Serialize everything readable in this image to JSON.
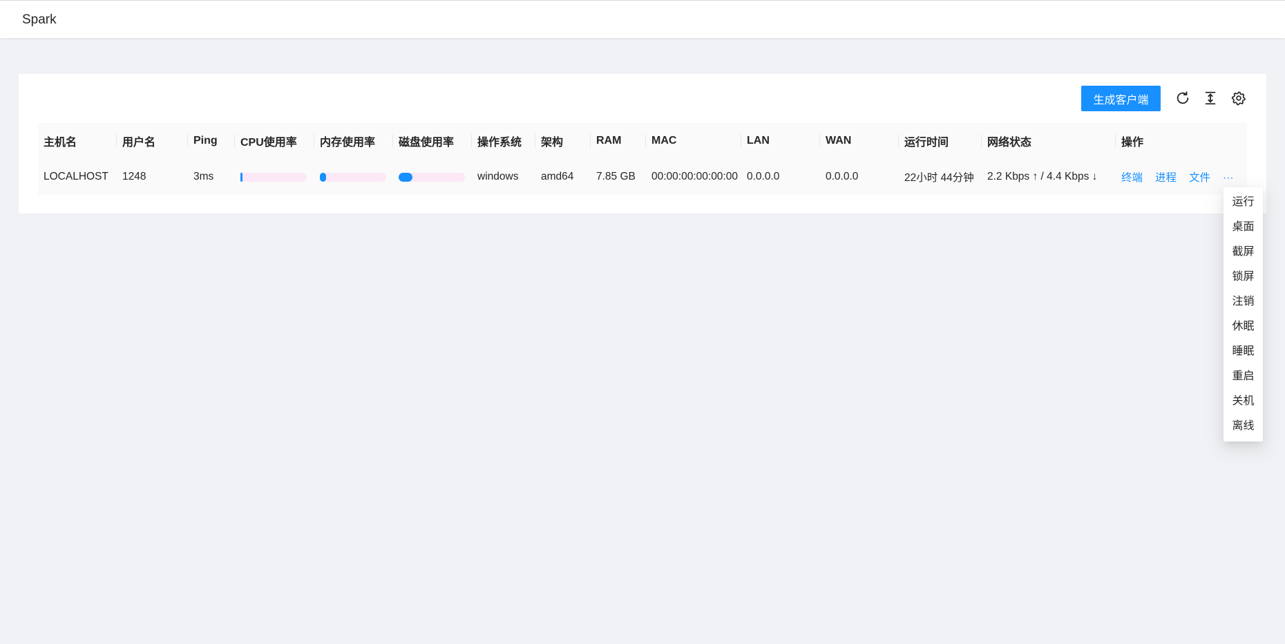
{
  "app": {
    "title": "Spark"
  },
  "toolbar": {
    "generate_client_label": "生成客户端",
    "icons": [
      "refresh-icon",
      "column-height-icon",
      "setting-icon"
    ]
  },
  "table": {
    "columns": [
      "主机名",
      "用户名",
      "Ping",
      "CPU使用率",
      "内存使用率",
      "磁盘使用率",
      "操作系统",
      "架构",
      "RAM",
      "MAC",
      "LAN",
      "WAN",
      "运行时间",
      "网络状态",
      "操作"
    ],
    "rows": [
      {
        "hostname": "LOCALHOST",
        "username": "1248",
        "ping": "3ms",
        "cpu_usage": 0.01,
        "mem_usage": 0.09,
        "disk_usage": 0.21,
        "os": "windows",
        "arch": "amd64",
        "ram": "7.85 GB",
        "mac": "00:00:00:00:00:00",
        "lan": "0.0.0.0",
        "wan": "0.0.0.0",
        "uptime": "22小时 44分钟",
        "network": "2.2 Kbps ↑ / 4.4 Kbps ↓",
        "actions": [
          "终端",
          "进程",
          "文件"
        ],
        "more": "···"
      }
    ]
  },
  "dropdown": {
    "items": [
      "运行",
      "桌面",
      "截屏",
      "锁屏",
      "注销",
      "休眠",
      "睡眠",
      "重启",
      "关机",
      "离线"
    ]
  },
  "colors": {
    "primary": "#1890ff",
    "bar_track": "#fde8f8",
    "background": "#f0f2f5"
  }
}
